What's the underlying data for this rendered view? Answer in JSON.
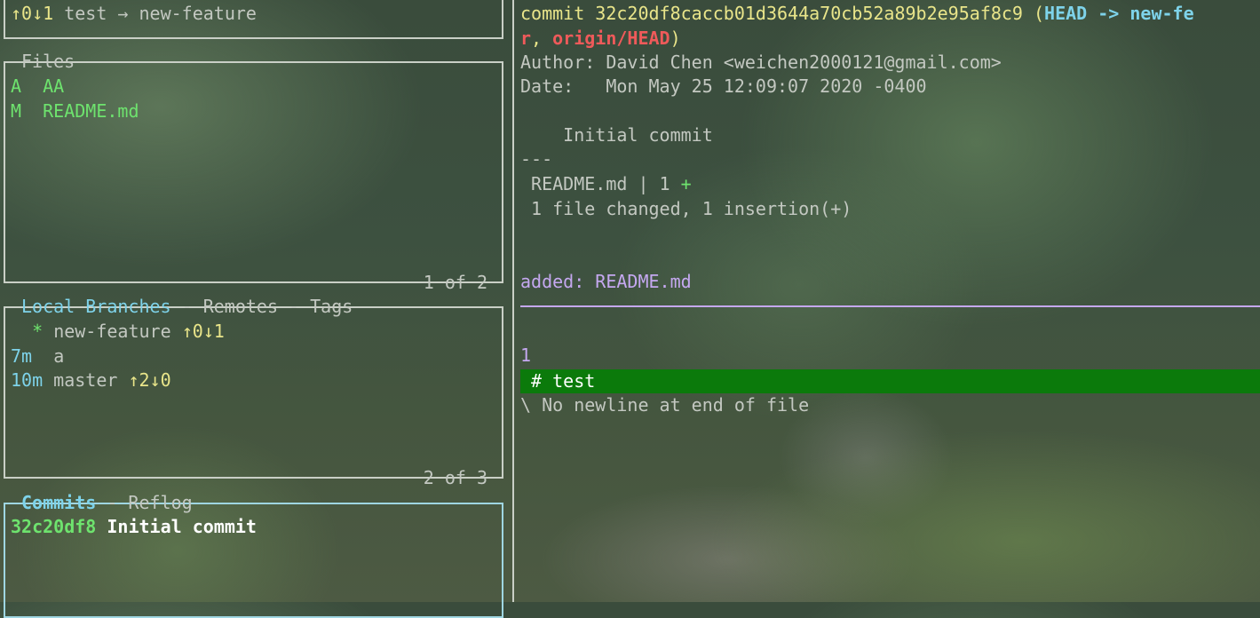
{
  "status": {
    "arrows": "↑0↓1",
    "text": "test → new-feature"
  },
  "files_panel": {
    "title": "Files",
    "footer": "1 of 2",
    "items": [
      {
        "status": "A",
        "name": "AA"
      },
      {
        "status": "M",
        "name": "README.md"
      }
    ]
  },
  "branches_panel": {
    "tab_active": "Local Branches",
    "tab_sep": " - ",
    "tab_remotes": "Remotes",
    "tab_tags": "Tags",
    "footer": "2 of 3",
    "items": [
      {
        "age": "",
        "marker": "*",
        "name": "new-feature",
        "tracking": "↑0↓1"
      },
      {
        "age": "7m",
        "marker": "",
        "name": "a",
        "tracking": ""
      },
      {
        "age": "10m",
        "marker": "",
        "name": "master",
        "tracking": "↑2↓0"
      }
    ]
  },
  "commits_panel": {
    "tab_active": "Commits",
    "tab_sep": " - ",
    "tab_reflog": "Reflog",
    "items": [
      {
        "sha": "32c20df8",
        "message": "Initial commit"
      }
    ]
  },
  "main_view": {
    "commit_prefix": "commit ",
    "commit_hash": "32c20df8caccb01d3644a70cb52a89b2e95af8c9",
    "ref_open": " (",
    "ref_head": "HEAD -> new-fe",
    "ref_wrap": "r",
    "ref_sep": ", ",
    "ref_origin": "origin/HEAD",
    "ref_close": ")",
    "author_line": "Author: David Chen <weichen2000121@gmail.com>",
    "date_line": "Date:   Mon May 25 12:09:07 2020 -0400",
    "message": "    Initial commit",
    "separator": "---",
    "stat_file": " README.md | 1 ",
    "stat_plus": "+",
    "stat_summary": " 1 file changed, 1 insertion(+)",
    "added_label": "added: README.md",
    "hunk_header": "1",
    "added_line": " # test",
    "no_newline": "\\ No newline at end of file"
  },
  "colors": {
    "active_border": "#9fd6e2",
    "inactive_border": "#c9cfc6",
    "added_bg": "#0b7a0b",
    "green": "#6ee36e",
    "cyan": "#7ed3ea",
    "yellow": "#e9e58a",
    "red": "#ef5a5a",
    "purple": "#c5a8f0"
  }
}
